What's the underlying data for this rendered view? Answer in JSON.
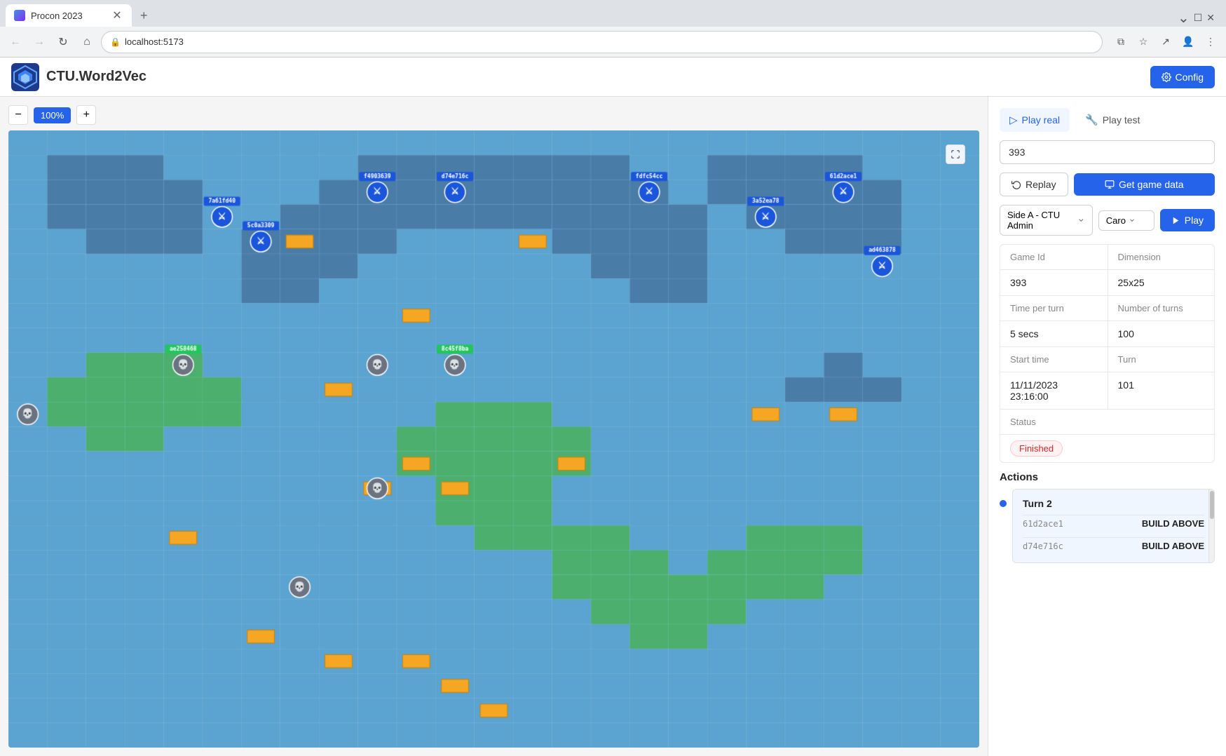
{
  "browser": {
    "tab_title": "Procon 2023",
    "url": "localhost:5173",
    "new_tab_label": "+"
  },
  "header": {
    "logo_text": "CTU.Word2Vec",
    "config_label": "Config"
  },
  "zoom": {
    "level": "100%",
    "zoom_in_label": "+",
    "zoom_out_label": "−"
  },
  "sidebar": {
    "play_real_label": "Play real",
    "play_test_label": "Play test",
    "game_id_value": "393",
    "game_id_placeholder": "Game ID",
    "replay_label": "Replay",
    "get_game_data_label": "Get game data",
    "side_selector_label": "Side A - CTU Admin",
    "caro_selector_label": "Caro",
    "play_label": "Play",
    "info": {
      "game_id_header": "Game Id",
      "dimension_header": "Dimension",
      "game_id_value": "393",
      "dimension_value": "25x25",
      "time_per_turn_header": "Time per turn",
      "number_of_turns_header": "Number of turns",
      "time_per_turn_value": "5 secs",
      "number_of_turns_value": "100",
      "start_time_header": "Start time",
      "turn_header": "Turn",
      "start_time_value": "11/11/2023 23:16:00",
      "turn_value": "101",
      "status_header": "Status",
      "status_value": "Finished"
    },
    "actions": {
      "title": "Actions",
      "turn_label": "Turn 2",
      "entries": [
        {
          "agent": "61d2ace1",
          "action": "BUILD ABOVE"
        },
        {
          "agent": "d74e716c",
          "action": "BUILD ABOVE"
        }
      ]
    }
  }
}
